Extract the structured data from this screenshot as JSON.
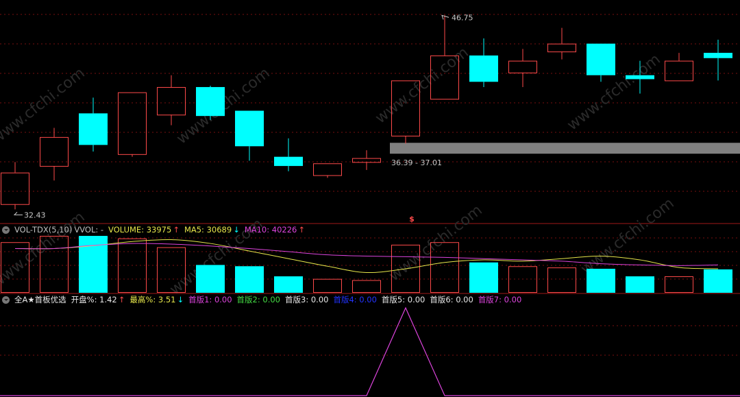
{
  "chart_data": [
    {
      "type": "candlestick",
      "panel": "price",
      "ylim": [
        31.5,
        47.5
      ],
      "annotations": {
        "high_label": "46.75",
        "low_label": "32.43",
        "band_label": "36.39 - 37.01",
        "marker": "$"
      },
      "band": {
        "from_index": 10,
        "low": 36.39,
        "high": 37.01,
        "color": "#808080"
      },
      "candles": [
        {
          "o": 32.4,
          "c": 34.8,
          "h": 35.6,
          "l": 32.0
        },
        {
          "o": 35.3,
          "c": 37.5,
          "h": 38.2,
          "l": 34.2
        },
        {
          "o": 39.3,
          "c": 36.9,
          "h": 40.5,
          "l": 36.4
        },
        {
          "o": 36.2,
          "c": 40.9,
          "h": 40.9,
          "l": 36.0
        },
        {
          "o": 39.2,
          "c": 41.3,
          "h": 42.2,
          "l": 38.4
        },
        {
          "o": 41.3,
          "c": 39.1,
          "h": 41.4,
          "l": 38.8
        },
        {
          "o": 39.5,
          "c": 36.8,
          "h": 39.5,
          "l": 35.7
        },
        {
          "o": 36.0,
          "c": 35.3,
          "h": 37.4,
          "l": 34.9
        },
        {
          "o": 34.6,
          "c": 35.5,
          "h": 35.5,
          "l": 34.4
        },
        {
          "o": 35.6,
          "c": 35.9,
          "h": 36.5,
          "l": 35.0
        },
        {
          "o": 37.6,
          "c": 41.8,
          "h": 41.8,
          "l": 37.0
        },
        {
          "o": 40.4,
          "c": 43.7,
          "h": 46.75,
          "l": 40.4
        },
        {
          "o": 43.7,
          "c": 41.7,
          "h": 45.0,
          "l": 41.3
        },
        {
          "o": 42.4,
          "c": 43.3,
          "h": 44.2,
          "l": 41.3
        },
        {
          "o": 44.0,
          "c": 44.6,
          "h": 45.8,
          "l": 43.4
        },
        {
          "o": 44.6,
          "c": 42.2,
          "h": 44.6,
          "l": 41.7
        },
        {
          "o": 42.2,
          "c": 41.9,
          "h": 43.3,
          "l": 40.8
        },
        {
          "o": 41.8,
          "c": 43.3,
          "h": 43.9,
          "l": 41.8
        },
        {
          "o": 43.9,
          "c": 43.5,
          "h": 44.9,
          "l": 41.8
        }
      ]
    },
    {
      "type": "bar",
      "panel": "volume",
      "indicator": "VOL-TDX(5,10)",
      "header": {
        "name": "VOL-TDX(5,10)",
        "vvol": "VVOL: -",
        "volume": "VOLUME: 33975",
        "volume_arrow": "↑",
        "ma5": "MA5: 30689",
        "ma5_arrow": "↓",
        "ma10": "MA10: 40226",
        "ma10_arrow": "↑"
      },
      "ylim": [
        0,
        45000
      ],
      "values": [
        40000,
        48000,
        45000,
        43000,
        36000,
        22000,
        21000,
        13000,
        11000,
        10000,
        38000,
        40000,
        24000,
        21000,
        20000,
        19000,
        13000,
        13000,
        18500
      ],
      "up": [
        true,
        true,
        false,
        true,
        true,
        false,
        false,
        false,
        true,
        true,
        true,
        true,
        false,
        true,
        true,
        false,
        false,
        true,
        false
      ],
      "series": [
        {
          "name": "MA5",
          "color": "#e6e64a",
          "values": [
            35000,
            35000,
            37200,
            40500,
            42000,
            39000,
            33000,
            27000,
            21000,
            16000,
            19000,
            24000,
            26000,
            25000,
            27000,
            29000,
            26000,
            20000,
            19000
          ]
        },
        {
          "name": "MA10",
          "color": "#dd44dd",
          "values": [
            35000,
            35000,
            37500,
            39000,
            38500,
            37000,
            35000,
            32500,
            30000,
            29000,
            28500,
            28000,
            27000,
            26000,
            25000,
            23000,
            22000,
            21500,
            22000
          ]
        }
      ]
    },
    {
      "type": "line",
      "panel": "indicator",
      "header": {
        "name": "全A★首板优选",
        "open": "开盘%: 1.42",
        "open_arrow": "↑",
        "high": "最高%: 3.51",
        "high_arrow": "↓",
        "b1": "首版1: 0.00",
        "b2": "首版2: 0.00",
        "b3": "首版3: 0.00",
        "b4": "首版4: 0.00",
        "b5": "首版5: 0.00",
        "b6": "首版6: 0.00",
        "b7": "首版7: 0.00"
      },
      "ylim": [
        0,
        1
      ],
      "values": [
        0,
        0,
        0,
        0,
        0,
        0,
        0,
        0,
        0,
        0,
        1,
        0,
        0,
        0,
        0,
        0,
        0,
        0,
        0
      ]
    }
  ],
  "colors": {
    "up": "#ff4a4a",
    "down": "#00ffff",
    "ma5": "#e6e64a",
    "ma10": "#dd44dd",
    "signal": "#dd44dd",
    "grid": "#7a1010",
    "separator": "#a01818",
    "text": "#c0c0c0",
    "watermark": "#2a2a2a"
  },
  "watermark": "www.cfchi.com"
}
